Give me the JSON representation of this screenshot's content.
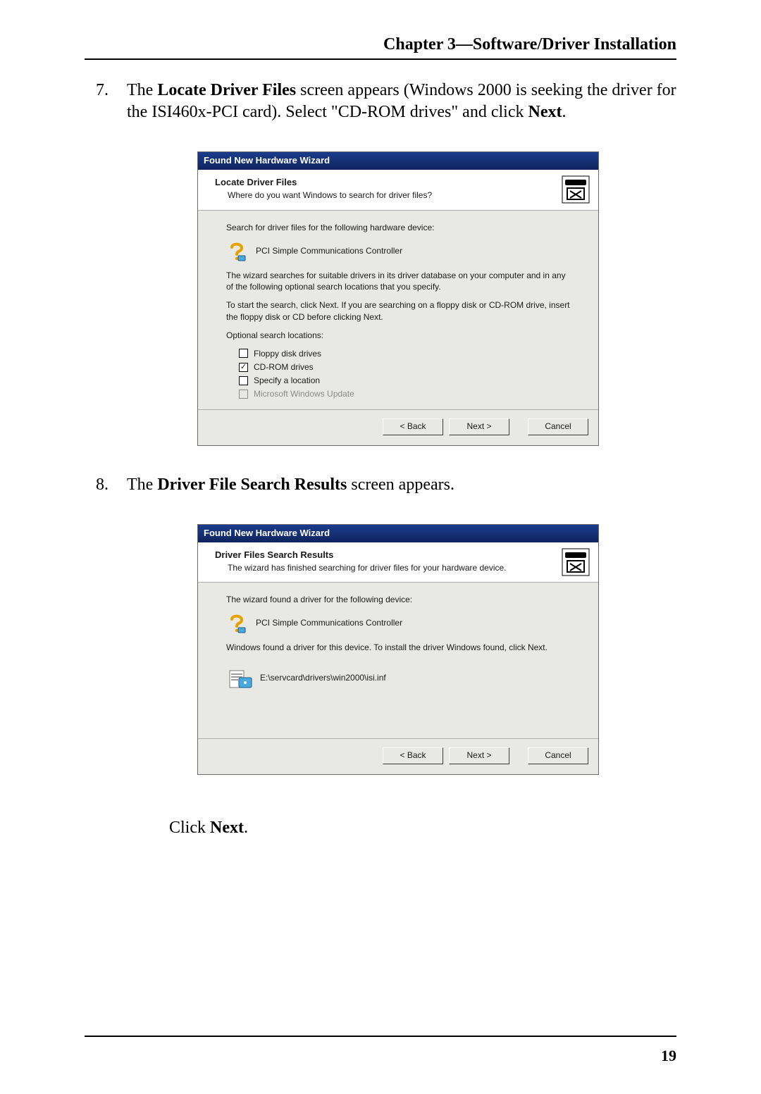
{
  "header": {
    "chapter_title": "Chapter 3—Software/Driver Installation"
  },
  "footer": {
    "page_number": "19"
  },
  "steps": {
    "seven": {
      "number": "7.",
      "t1": "The ",
      "bold1": "Locate Driver Files",
      "t2": " screen appears (Windows 2000 is seeking the driver for the ISI460x-PCI card).  Select \"CD-ROM drives\" and click ",
      "bold2": "Next",
      "t3": "."
    },
    "eight": {
      "number": "8.",
      "t1": "The ",
      "bold1": "Driver File Search Results",
      "t2": " screen appears."
    }
  },
  "click_next": {
    "t1": "Click ",
    "bold": "Next",
    "t2": "."
  },
  "dialog1": {
    "titlebar": "Found New Hardware Wizard",
    "heading": "Locate Driver Files",
    "subheading": "Where do you want Windows to search for driver files?",
    "body": {
      "p1": "Search for driver files for the following hardware device:",
      "device": "PCI Simple Communications Controller",
      "p2": "The wizard searches for suitable drivers in its driver database on your computer and in any of the following optional search locations that you specify.",
      "p3": "To start the search, click Next. If you are searching on a floppy disk or CD-ROM drive, insert the floppy disk or CD before clicking Next.",
      "p4": "Optional search locations:",
      "options": {
        "floppy": {
          "label": "Floppy disk drives",
          "checked": false,
          "enabled": true
        },
        "cdrom": {
          "label": "CD-ROM drives",
          "checked": true,
          "enabled": true
        },
        "specify": {
          "label": "Specify a location",
          "checked": false,
          "enabled": true
        },
        "msupdate": {
          "label": "Microsoft Windows Update",
          "checked": false,
          "enabled": false
        }
      }
    },
    "buttons": {
      "back": "< Back",
      "next": "Next >",
      "cancel": "Cancel"
    }
  },
  "dialog2": {
    "titlebar": "Found New Hardware Wizard",
    "heading": "Driver Files Search Results",
    "subheading": "The wizard has finished searching for driver files for your hardware device.",
    "body": {
      "p1": "The wizard found a driver for the following device:",
      "device": "PCI Simple Communications Controller",
      "p2": "Windows found a driver for this device. To install the driver Windows found, click Next.",
      "path": "E:\\servcard\\drivers\\win2000\\isi.inf"
    },
    "buttons": {
      "back": "< Back",
      "next": "Next >",
      "cancel": "Cancel"
    }
  }
}
